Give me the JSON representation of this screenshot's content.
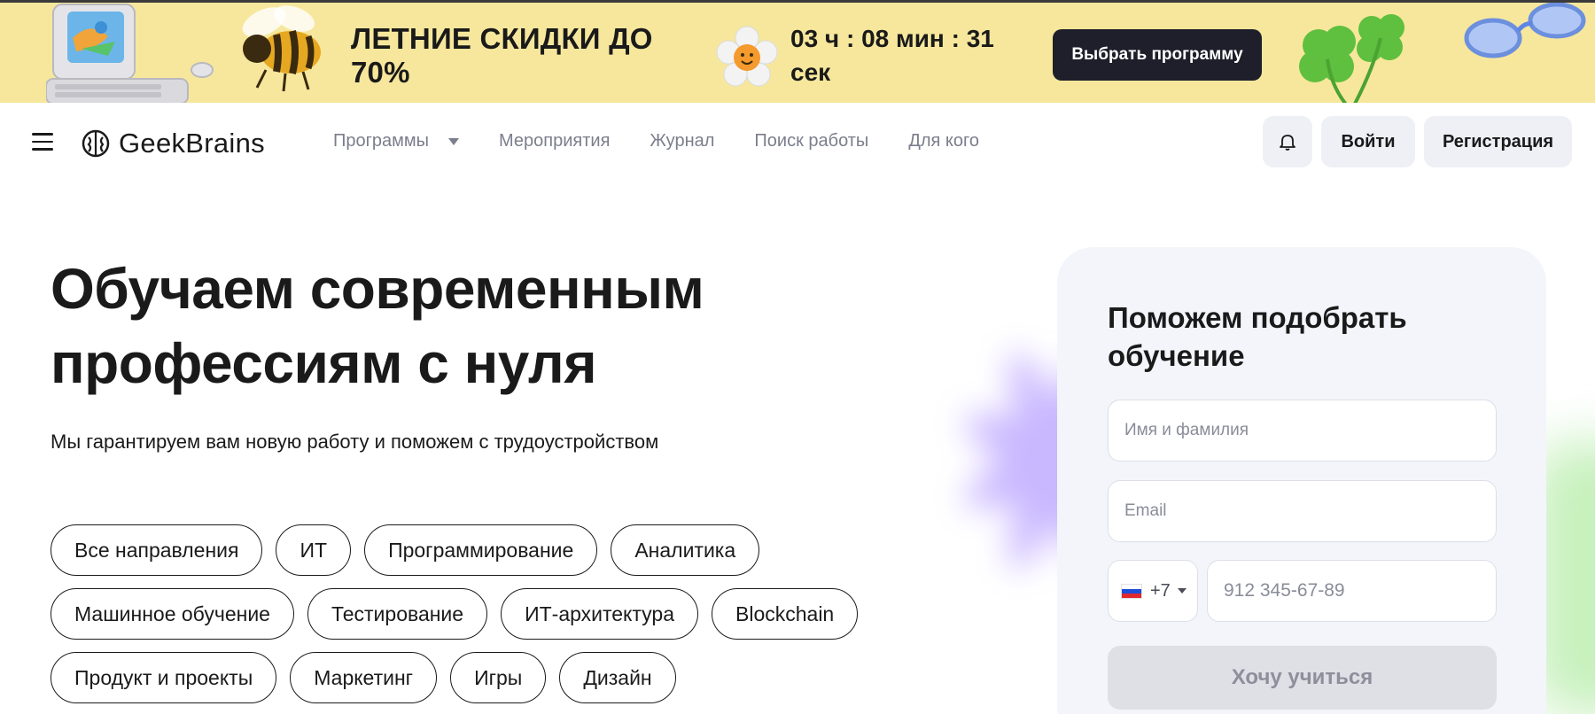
{
  "promo": {
    "title": "ЛЕТНИЕ СКИДКИ ДО 70%",
    "timer": "03 ч : 08 мин : 31 сек",
    "button_label": "Выбрать программу"
  },
  "header": {
    "logo_text": "GeekBrains",
    "nav": [
      {
        "label": "Программы"
      },
      {
        "label": "Мероприятия"
      },
      {
        "label": "Журнал"
      },
      {
        "label": "Поиск работы"
      },
      {
        "label": "Для кого"
      }
    ],
    "login_label": "Войти",
    "register_label": "Регистрация"
  },
  "hero": {
    "title": "Обучаем современным профессиям с нуля",
    "subtitle": "Мы гарантируем вам новую работу и поможем с трудоустройством",
    "chips": [
      [
        "Все направления",
        "ИТ",
        "Программирование",
        "Аналитика"
      ],
      [
        "Машинное обучение",
        "Тестирование",
        "ИТ-архитектура",
        "Blockchain"
      ],
      [
        "Продукт и проекты",
        "Маркетинг",
        "Игры",
        "Дизайн"
      ]
    ]
  },
  "form": {
    "title": "Поможем подобрать обучение",
    "name_placeholder": "Имя и фамилия",
    "email_placeholder": "Email",
    "phone_code": "+7",
    "phone_placeholder": "912 345-67-89",
    "submit_label": "Хочу учиться"
  },
  "colors": {
    "banner_bg": "#f6e79c",
    "dark_button": "#1f1f2b",
    "nav_text": "#7b7e8c",
    "card_bg": "#f4f5fa",
    "disabled_button": "#dfe0e6"
  }
}
